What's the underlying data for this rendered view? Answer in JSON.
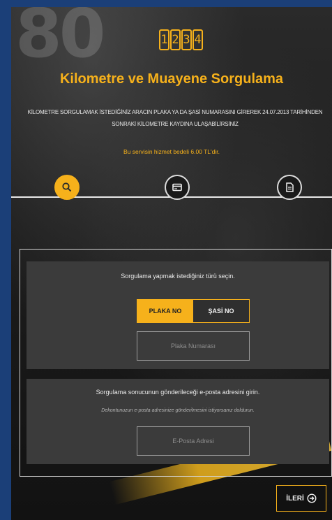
{
  "logo": {
    "digits": [
      "1",
      "2",
      "3",
      "4"
    ]
  },
  "title": "Kilometre ve Muayene Sorgulama",
  "description": "KİLOMETRE SORGULAMAK İSTEDİĞİNİZ ARACIN PLAKA YA DA ŞASİ NUMARASINI GİREREK 24.07.2013 TARİHİNDEN SONRAKİ KİLOMETRE KAYDINA ULAŞABİLİRSİNİZ",
  "fee_note": "Bu servisin hizmet bedeli 6.00 TL'dir.",
  "steps": [
    {
      "icon": "search-icon",
      "state": "active"
    },
    {
      "icon": "card-icon",
      "state": "idle"
    },
    {
      "icon": "document-icon",
      "state": "idle"
    }
  ],
  "query": {
    "label": "Sorgulama yapmak istediğiniz türü seçin.",
    "plaka_label": "PLAKA NO",
    "sasi_label": "ŞASİ NO",
    "selected": "PLAKA NO",
    "plate_placeholder": "Plaka Numarası"
  },
  "email": {
    "label": "Sorgulama sonucunun gönderileceği e-posta adresini girin.",
    "hint": "Dekontunuzun e-posta adresinize gönderilmesini istiyorsanız doldurun.",
    "placeholder": "E-Posta Adresi"
  },
  "next_label": "İLERİ",
  "colors": {
    "accent": "#f6b11b",
    "panel": "#3b3b3b",
    "background": "#1b1b1b",
    "page_border": "#1b3f78"
  }
}
